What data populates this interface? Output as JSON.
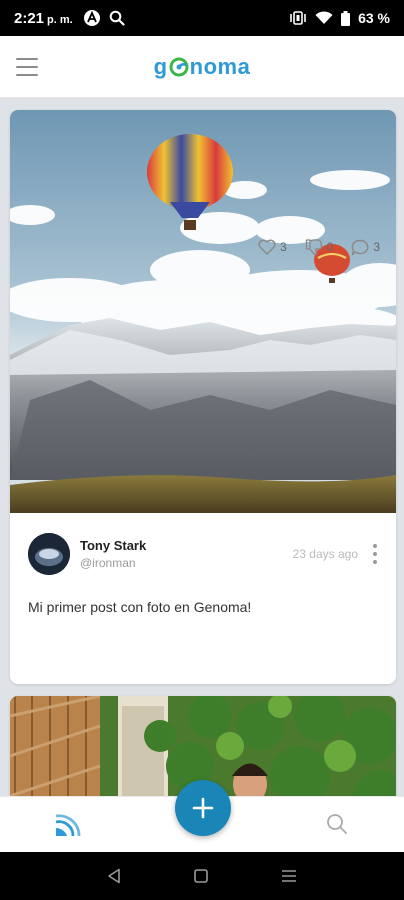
{
  "status_bar": {
    "time": "2:21",
    "period": "p. m.",
    "battery": "63 %"
  },
  "header": {
    "logo_prefix": "g",
    "logo_suffix": "noma",
    "menu_icon": "hamburger-icon"
  },
  "posts": [
    {
      "author_name": "Tony Stark",
      "author_handle": "@ironman",
      "time_ago": "23 days ago",
      "text": "Mi primer post con foto en Genoma!",
      "likes": "3",
      "dislikes": "0",
      "comments": "3"
    }
  ],
  "bottom_nav": {
    "left_icon": "feed-signal-icon",
    "center_icon": "plus-icon",
    "right_icon": "search-icon"
  },
  "colors": {
    "accent": "#1a86b8",
    "logo": "#2e9bd6",
    "background": "#dfe3e8"
  }
}
